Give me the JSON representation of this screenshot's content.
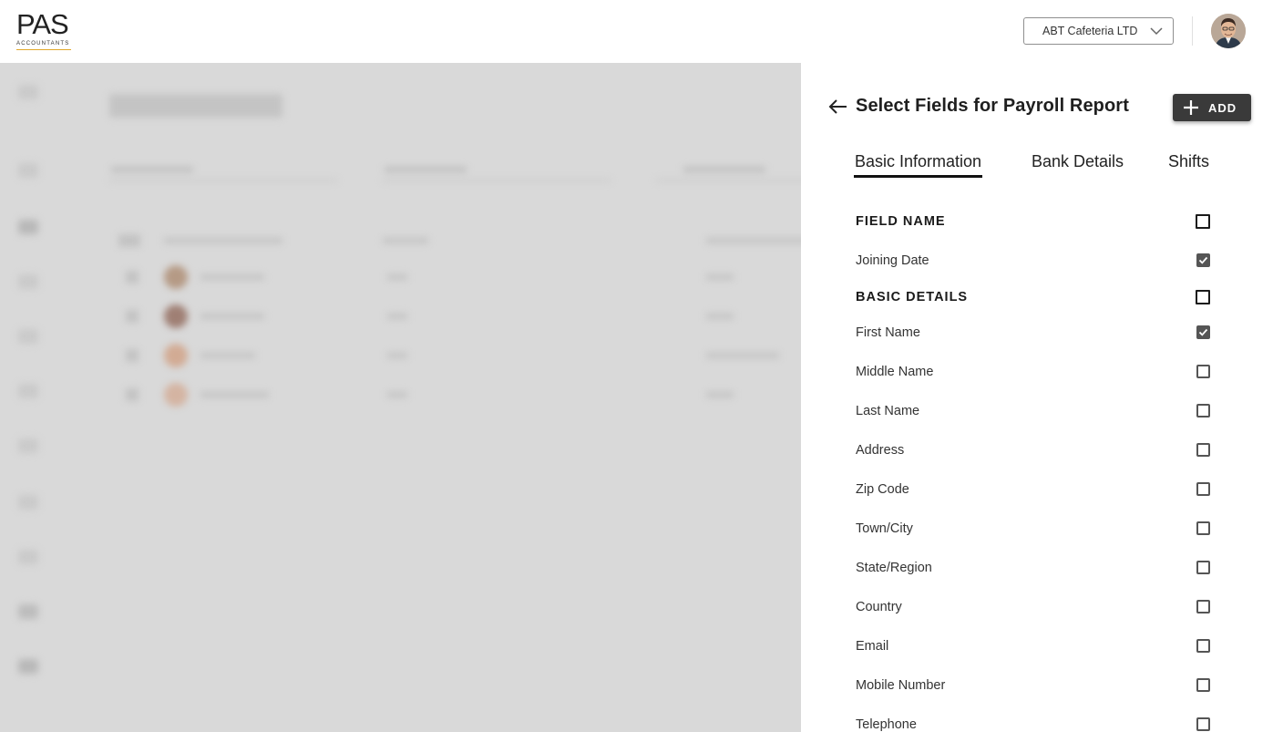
{
  "header": {
    "logo_main": "PAS",
    "logo_sub": "ACCOUNTANTS",
    "company_select_value": "ABT Cafeteria LTD",
    "brand_accent": "#e1a92b"
  },
  "panel": {
    "title": "Select Fields for Payroll Report",
    "add_label": "ADD",
    "tabs": [
      {
        "label": "Basic Information",
        "active": true
      },
      {
        "label": "Bank Details",
        "active": false
      },
      {
        "label": "Shifts",
        "active": false
      }
    ],
    "rows": [
      {
        "label": "FIELD NAME",
        "section": true,
        "checked": false
      },
      {
        "label": "Joining Date",
        "section": false,
        "checked": true
      },
      {
        "label": "BASIC DETAILS",
        "section": true,
        "checked": false
      },
      {
        "label": "First Name",
        "section": false,
        "checked": true
      },
      {
        "label": "Middle Name",
        "section": false,
        "checked": false
      },
      {
        "label": "Last Name",
        "section": false,
        "checked": false
      },
      {
        "label": "Address",
        "section": false,
        "checked": false
      },
      {
        "label": "Zip Code",
        "section": false,
        "checked": false
      },
      {
        "label": "Town/City",
        "section": false,
        "checked": false
      },
      {
        "label": "State/Region",
        "section": false,
        "checked": false
      },
      {
        "label": "Country",
        "section": false,
        "checked": false
      },
      {
        "label": "Email",
        "section": false,
        "checked": false
      },
      {
        "label": "Mobile Number",
        "section": false,
        "checked": false
      },
      {
        "label": "Telephone",
        "section": false,
        "checked": false
      }
    ]
  }
}
